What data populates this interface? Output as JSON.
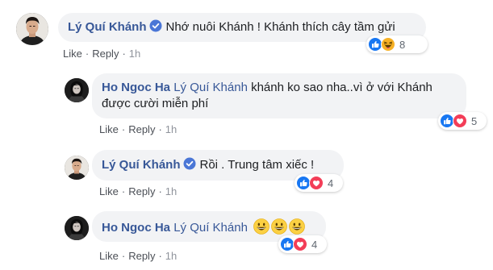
{
  "comments": [
    {
      "author": "Lý Quí Khánh",
      "text": "Nhớ nuôi Khánh ! Khánh thích cây tầm gửi",
      "reaction_count": "8",
      "actions": {
        "like": "Like",
        "reply": "Reply",
        "time": "1h"
      },
      "reactions": [
        "like-icon",
        "haha-icon"
      ]
    },
    {
      "author": "Ho Ngoc Ha",
      "mention": "Lý Quí Khánh",
      "text_line1": "khánh ko sao nha..vì ở với Khánh",
      "text_line2": "được cười miễn phí",
      "reaction_count": "5",
      "actions": {
        "like": "Like",
        "reply": "Reply",
        "time": "1h"
      },
      "reactions": [
        "like-icon",
        "love-icon"
      ]
    },
    {
      "author": "Lý Quí Khánh",
      "text": "Rồi . Trung tâm xiếc !",
      "reaction_count": "4",
      "actions": {
        "like": "Like",
        "reply": "Reply",
        "time": "1h"
      },
      "reactions": [
        "like-icon",
        "love-icon"
      ]
    },
    {
      "author": "Ho Ngoc Ha",
      "mention": "Lý Quí Khánh",
      "emojis": [
        "grinning-face-icon",
        "grinning-face-icon",
        "grinning-face-icon"
      ],
      "reaction_count": "4",
      "actions": {
        "like": "Like",
        "reply": "Reply",
        "time": "1h"
      },
      "reactions": [
        "like-icon",
        "love-icon"
      ]
    }
  ],
  "colors": {
    "link": "#385898",
    "bubble": "#f2f3f5",
    "like": "#1877f2",
    "love": "#f33e58",
    "haha": "#f7b125"
  }
}
